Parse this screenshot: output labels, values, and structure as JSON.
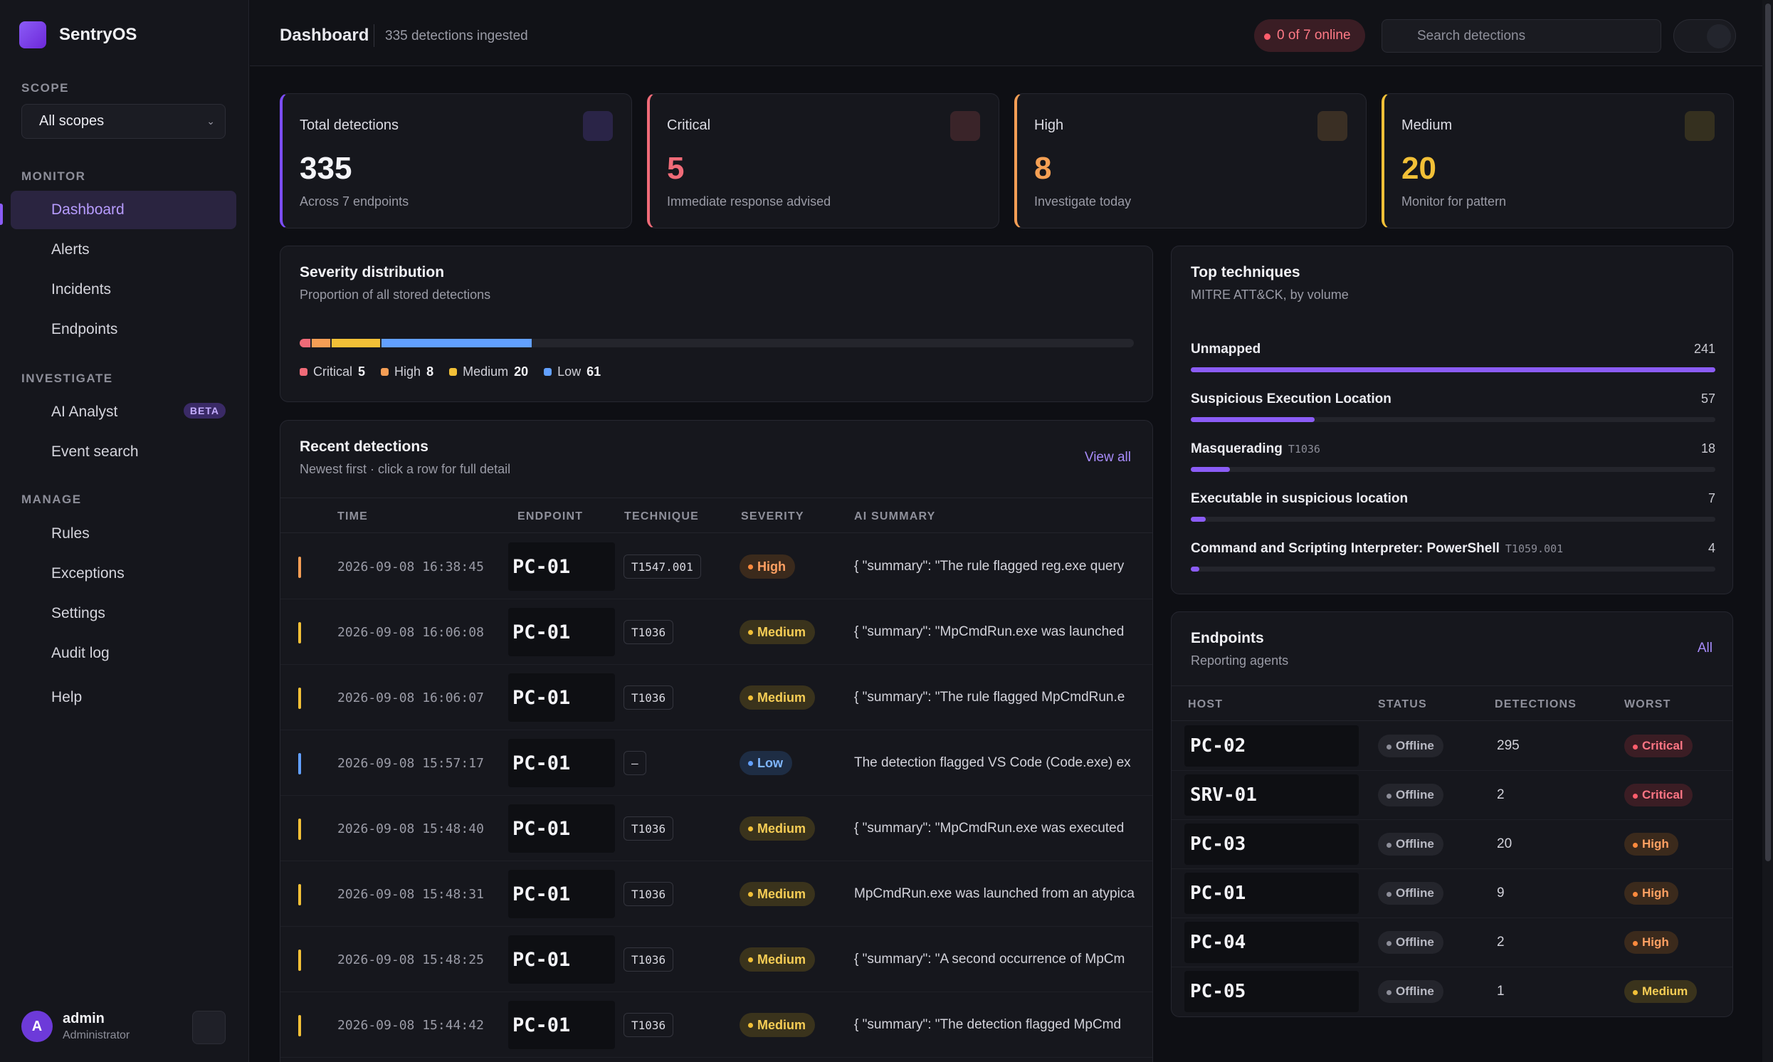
{
  "app": {
    "name": "SentryOS"
  },
  "sidebar": {
    "scope_label": "SCOPE",
    "scope_value": "All scopes",
    "monitor_label": "MONITOR",
    "monitor_items": [
      {
        "label": "Dashboard",
        "active": true
      },
      {
        "label": "Alerts"
      },
      {
        "label": "Incidents"
      },
      {
        "label": "Endpoints"
      }
    ],
    "investigate_label": "INVESTIGATE",
    "investigate_items": [
      {
        "label": "AI Analyst",
        "badge": "BETA"
      },
      {
        "label": "Event search"
      }
    ],
    "manage_label": "MANAGE",
    "manage_items": [
      {
        "label": "Rules"
      },
      {
        "label": "Exceptions"
      },
      {
        "label": "Settings"
      },
      {
        "label": "Audit log"
      }
    ],
    "help_label": "Help",
    "user": {
      "initial": "A",
      "name": "admin",
      "role": "Administrator"
    }
  },
  "header": {
    "title": "Dashboard",
    "subtitle": "335 detections ingested",
    "online": "0 of 7 online",
    "search_placeholder": "Search detections"
  },
  "kpis": [
    {
      "title": "Total detections",
      "value": "335",
      "caption": "Across 7 endpoints",
      "accent": "#7c4dff"
    },
    {
      "title": "Critical",
      "value": "5",
      "caption": "Immediate response advised",
      "accent": "#f06b78"
    },
    {
      "title": "High",
      "value": "8",
      "caption": "Investigate today",
      "accent": "#f59e55"
    },
    {
      "title": "Medium",
      "value": "20",
      "caption": "Monitor for pattern",
      "accent": "#f2c037"
    }
  ],
  "severity": {
    "title": "Severity distribution",
    "subtitle": "Proportion of all stored detections",
    "items": [
      {
        "label": "Critical",
        "count": 5,
        "color": "#f06b78"
      },
      {
        "label": "High",
        "count": 8,
        "color": "#f59e55"
      },
      {
        "label": "Medium",
        "count": 20,
        "color": "#f2c037"
      },
      {
        "label": "Low",
        "count": 61,
        "color": "#62a0ff"
      }
    ],
    "total": 335
  },
  "techniques": {
    "title": "Top techniques",
    "subtitle": "MITRE ATT&CK, by volume",
    "max": 241,
    "items": [
      {
        "name": "Unmapped",
        "id": "",
        "count": 241
      },
      {
        "name": "Suspicious Execution Location",
        "id": "",
        "count": 57
      },
      {
        "name": "Masquerading",
        "id": "T1036",
        "count": 18
      },
      {
        "name": "Executable in suspicious location",
        "id": "",
        "count": 7
      },
      {
        "name": "Command and Scripting Interpreter: PowerShell",
        "id": "T1059.001",
        "count": 4
      }
    ]
  },
  "recent": {
    "title": "Recent detections",
    "subtitle": "Newest first · click a row for full detail",
    "view_all": "View all",
    "columns": [
      "TIME",
      "ENDPOINT",
      "TECHNIQUE",
      "SEVERITY",
      "AI SUMMARY"
    ],
    "rows": [
      {
        "time": "2026-09-08 16:38:45",
        "endpoint": "PC-01",
        "technique": "T1547.001",
        "severity": "High",
        "summary": "{ \"summary\": \"The rule flagged reg.exe query"
      },
      {
        "time": "2026-09-08 16:06:08",
        "endpoint": "PC-01",
        "technique": "T1036",
        "severity": "Medium",
        "summary": "{ \"summary\": \"MpCmdRun.exe was launched"
      },
      {
        "time": "2026-09-08 16:06:07",
        "endpoint": "PC-01",
        "technique": "T1036",
        "severity": "Medium",
        "summary": "{ \"summary\": \"The rule flagged MpCmdRun.e"
      },
      {
        "time": "2026-09-08 15:57:17",
        "endpoint": "PC-01",
        "technique": "—",
        "severity": "Low",
        "summary": "The detection flagged VS Code (Code.exe) ex"
      },
      {
        "time": "2026-09-08 15:48:40",
        "endpoint": "PC-01",
        "technique": "T1036",
        "severity": "Medium",
        "summary": "{ \"summary\": \"MpCmdRun.exe was executed"
      },
      {
        "time": "2026-09-08 15:48:31",
        "endpoint": "PC-01",
        "technique": "T1036",
        "severity": "Medium",
        "summary": "MpCmdRun.exe was launched from an atypica"
      },
      {
        "time": "2026-09-08 15:48:25",
        "endpoint": "PC-01",
        "technique": "T1036",
        "severity": "Medium",
        "summary": "{ \"summary\": \"A second occurrence of MpCm"
      },
      {
        "time": "2026-09-08 15:44:42",
        "endpoint": "PC-01",
        "technique": "T1036",
        "severity": "Medium",
        "summary": "{ \"summary\": \"The detection flagged MpCmd"
      }
    ]
  },
  "endpoints": {
    "title": "Endpoints",
    "subtitle": "Reporting agents",
    "all_link": "All",
    "columns": [
      "HOST",
      "STATUS",
      "DETECTIONS",
      "WORST"
    ],
    "rows": [
      {
        "host": "PC-02",
        "status": "Offline",
        "detections": "295",
        "worst": "Critical"
      },
      {
        "host": "SRV-01",
        "status": "Offline",
        "detections": "2",
        "worst": "Critical"
      },
      {
        "host": "PC-03",
        "status": "Offline",
        "detections": "20",
        "worst": "High"
      },
      {
        "host": "PC-01",
        "status": "Offline",
        "detections": "9",
        "worst": "High"
      },
      {
        "host": "PC-04",
        "status": "Offline",
        "detections": "2",
        "worst": "High"
      },
      {
        "host": "PC-05",
        "status": "Offline",
        "detections": "1",
        "worst": "Medium"
      }
    ]
  },
  "icons": {
    "brand": "shield-logo-icon",
    "search": "search-icon",
    "theme": "theme-toggle-icon",
    "user_menu": "user-menu-icon"
  }
}
